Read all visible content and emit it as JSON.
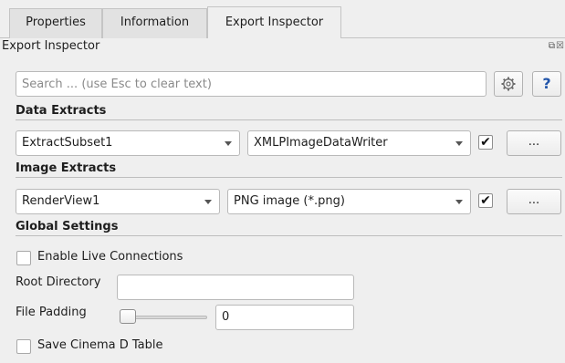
{
  "tabs": [
    {
      "label": "Properties"
    },
    {
      "label": "Information"
    },
    {
      "label": "Export Inspector",
      "active": true
    }
  ],
  "panel": {
    "title": "Export Inspector",
    "float_icons": "⧉☒"
  },
  "search": {
    "placeholder": "Search ... (use Esc to clear text)",
    "value": "",
    "settings_icon": "gear-icon",
    "help_icon": "question-mark-icon",
    "help_label": "?"
  },
  "data_extracts": {
    "heading": "Data Extracts",
    "source": "ExtractSubset1",
    "writer": "XMLPImageDataWriter",
    "enabled": true,
    "more_label": "..."
  },
  "image_extracts": {
    "heading": "Image Extracts",
    "source": "RenderView1",
    "writer": "PNG image (*.png)",
    "enabled": true,
    "more_label": "..."
  },
  "global_settings": {
    "heading": "Global Settings",
    "live_connections": {
      "label": "Enable Live Connections",
      "checked": false
    },
    "root_directory": {
      "label": "Root Directory",
      "value": ""
    },
    "file_padding": {
      "label": "File Padding",
      "value": "0",
      "slider_fraction": 0
    },
    "cinema_table": {
      "label": "Save Cinema D Table",
      "checked": false
    }
  },
  "colors": {
    "background": "#efefef",
    "help_accent": "#2255aa"
  }
}
